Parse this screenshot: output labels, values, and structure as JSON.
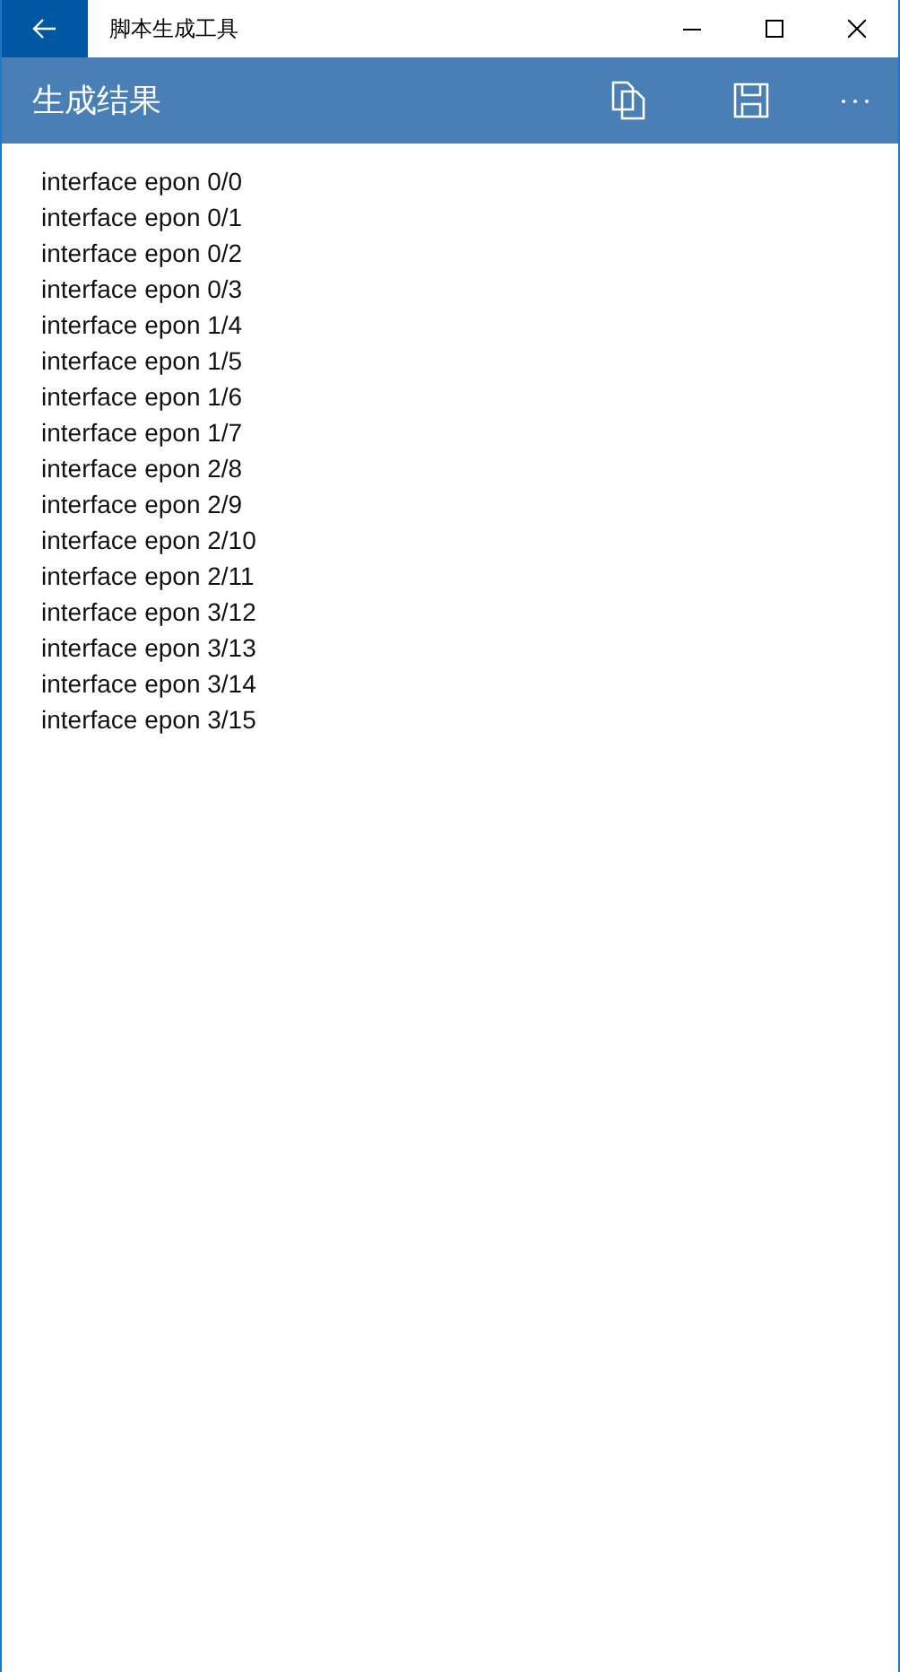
{
  "window": {
    "title": "脚本生成工具"
  },
  "app_bar": {
    "title": "生成结果"
  },
  "output_lines": [
    "interface epon 0/0",
    "interface epon 0/1",
    "interface epon 0/2",
    "interface epon 0/3",
    "interface epon 1/4",
    "interface epon 1/5",
    "interface epon 1/6",
    "interface epon 1/7",
    "interface epon 2/8",
    "interface epon 2/9",
    "interface epon 2/10",
    "interface epon 2/11",
    "interface epon 3/12",
    "interface epon 3/13",
    "interface epon 3/14",
    "interface epon 3/15"
  ]
}
